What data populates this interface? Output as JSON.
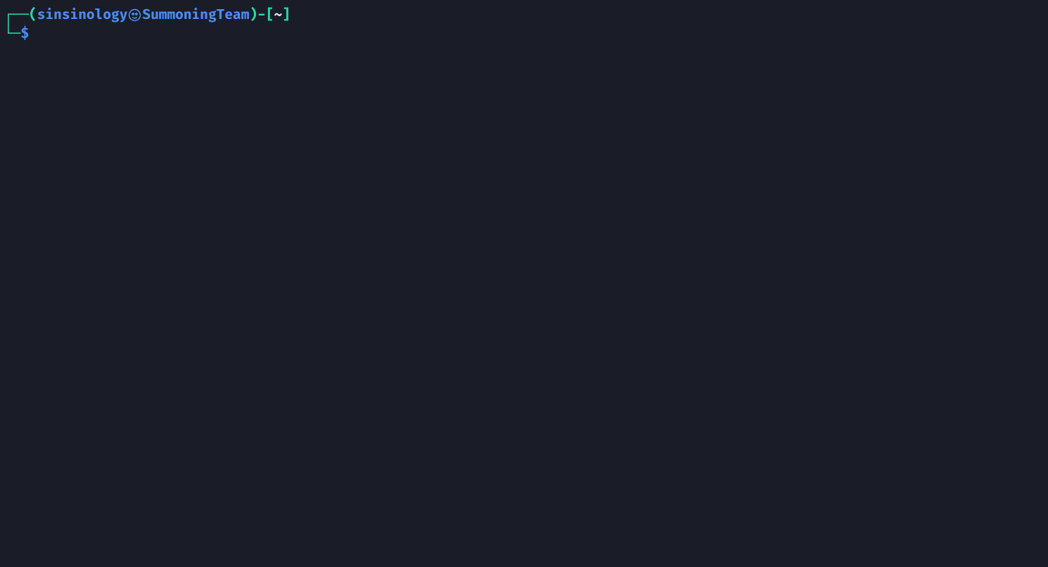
{
  "prompt": {
    "box_top": "┌──",
    "paren_open": "(",
    "username": "sinsinology",
    "skull_glyph": "㉿",
    "hostname": "SummoningTeam",
    "paren_close": ")",
    "dash": "-",
    "bracket_open": "[",
    "cwd": "~",
    "bracket_close": "]",
    "box_bottom": "└─",
    "dollar": "$",
    "command": ""
  },
  "colors": {
    "background": "#1a1d27",
    "green": "#2bd4a8",
    "blue": "#4a8cf7",
    "white": "#e6e6e6"
  }
}
